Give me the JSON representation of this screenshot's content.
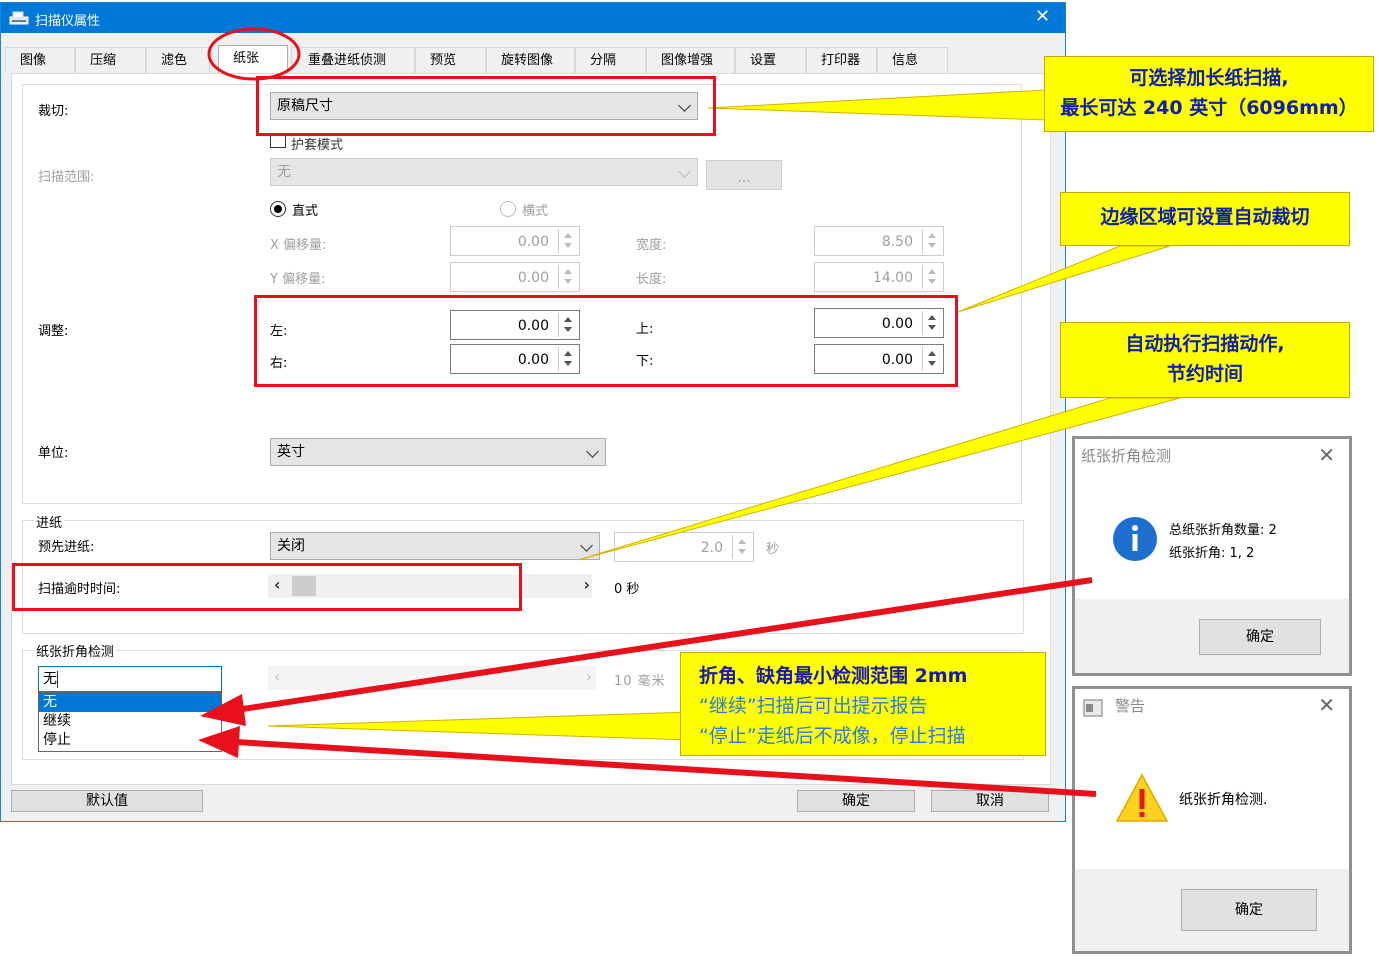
{
  "window": {
    "title": "扫描仪属性",
    "close": "✕"
  },
  "tabs": [
    "图像",
    "压缩",
    "滤色",
    "纸张",
    "重叠进纸侦测",
    "预览",
    "旋转图像",
    "分隔",
    "图像增强",
    "设置",
    "打印器",
    "信息"
  ],
  "crop": {
    "label": "裁切:",
    "value": "原稿尺寸",
    "sleeve_mode": "护套模式"
  },
  "scan_range": {
    "label": "扫描范围:",
    "value": "无",
    "browse": "..."
  },
  "orientation": {
    "portrait": "直式",
    "landscape": "横式"
  },
  "offset": {
    "x_label": "X 偏移量:",
    "x_value": "0.00",
    "y_label": "Y 偏移量:",
    "y_value": "0.00",
    "width_label": "宽度:",
    "width_value": "8.50",
    "length_label": "长度:",
    "length_value": "14.00"
  },
  "adjust": {
    "label": "调整:",
    "left_label": "左:",
    "left_value": "0.00",
    "right_label": "右:",
    "right_value": "0.00",
    "top_label": "上:",
    "top_value": "0.00",
    "bottom_label": "下:",
    "bottom_value": "0.00"
  },
  "unit": {
    "label": "单位:",
    "value": "英寸"
  },
  "feed": {
    "group": "进纸",
    "prefeed_label": "预先进纸:",
    "prefeed_value": "关闭",
    "prefeed_seconds": "2.0",
    "seconds_unit": "秒",
    "timeout_label": "扫描逾时时间:",
    "timeout_value": "0 秒",
    "timeout_slider_fraction": 0
  },
  "folded": {
    "group": "纸张折角检测",
    "value": "无",
    "options": [
      "无",
      "继续",
      "停止"
    ],
    "range_value": "10 毫米"
  },
  "buttons": {
    "default": "默认值",
    "ok": "确定",
    "cancel": "取消"
  },
  "callouts": {
    "long_paper_line1": "可选择加长纸扫描,",
    "long_paper_line2": "最长可达 240 英寸（6096mm）",
    "edge_crop": "边缘区域可设置自动裁切",
    "auto_scan_line1": "自动执行扫描动作,",
    "auto_scan_line2": "节约时间",
    "fold_line1": "折角、缺角最小检测范围 2mm",
    "fold_line2": "“继续”扫描后可出提示报告",
    "fold_line3": "“停止”走纸后不成像，停止扫描"
  },
  "dialog_info": {
    "title": "纸张折角检测",
    "line1": "总纸张折角数量: 2",
    "line2": "纸张折角: 1, 2",
    "ok": "确定",
    "close": "✕"
  },
  "dialog_warning": {
    "title": "警告",
    "message": "纸张折角检测.",
    "ok": "确定",
    "close": "✕"
  },
  "colors": {
    "title_bar": "#0078d7",
    "annotation_red": "#e8101a",
    "callout_yellow": "#ffff00",
    "callout_text": "#0f20a8",
    "selection_blue": "#0078d7"
  }
}
